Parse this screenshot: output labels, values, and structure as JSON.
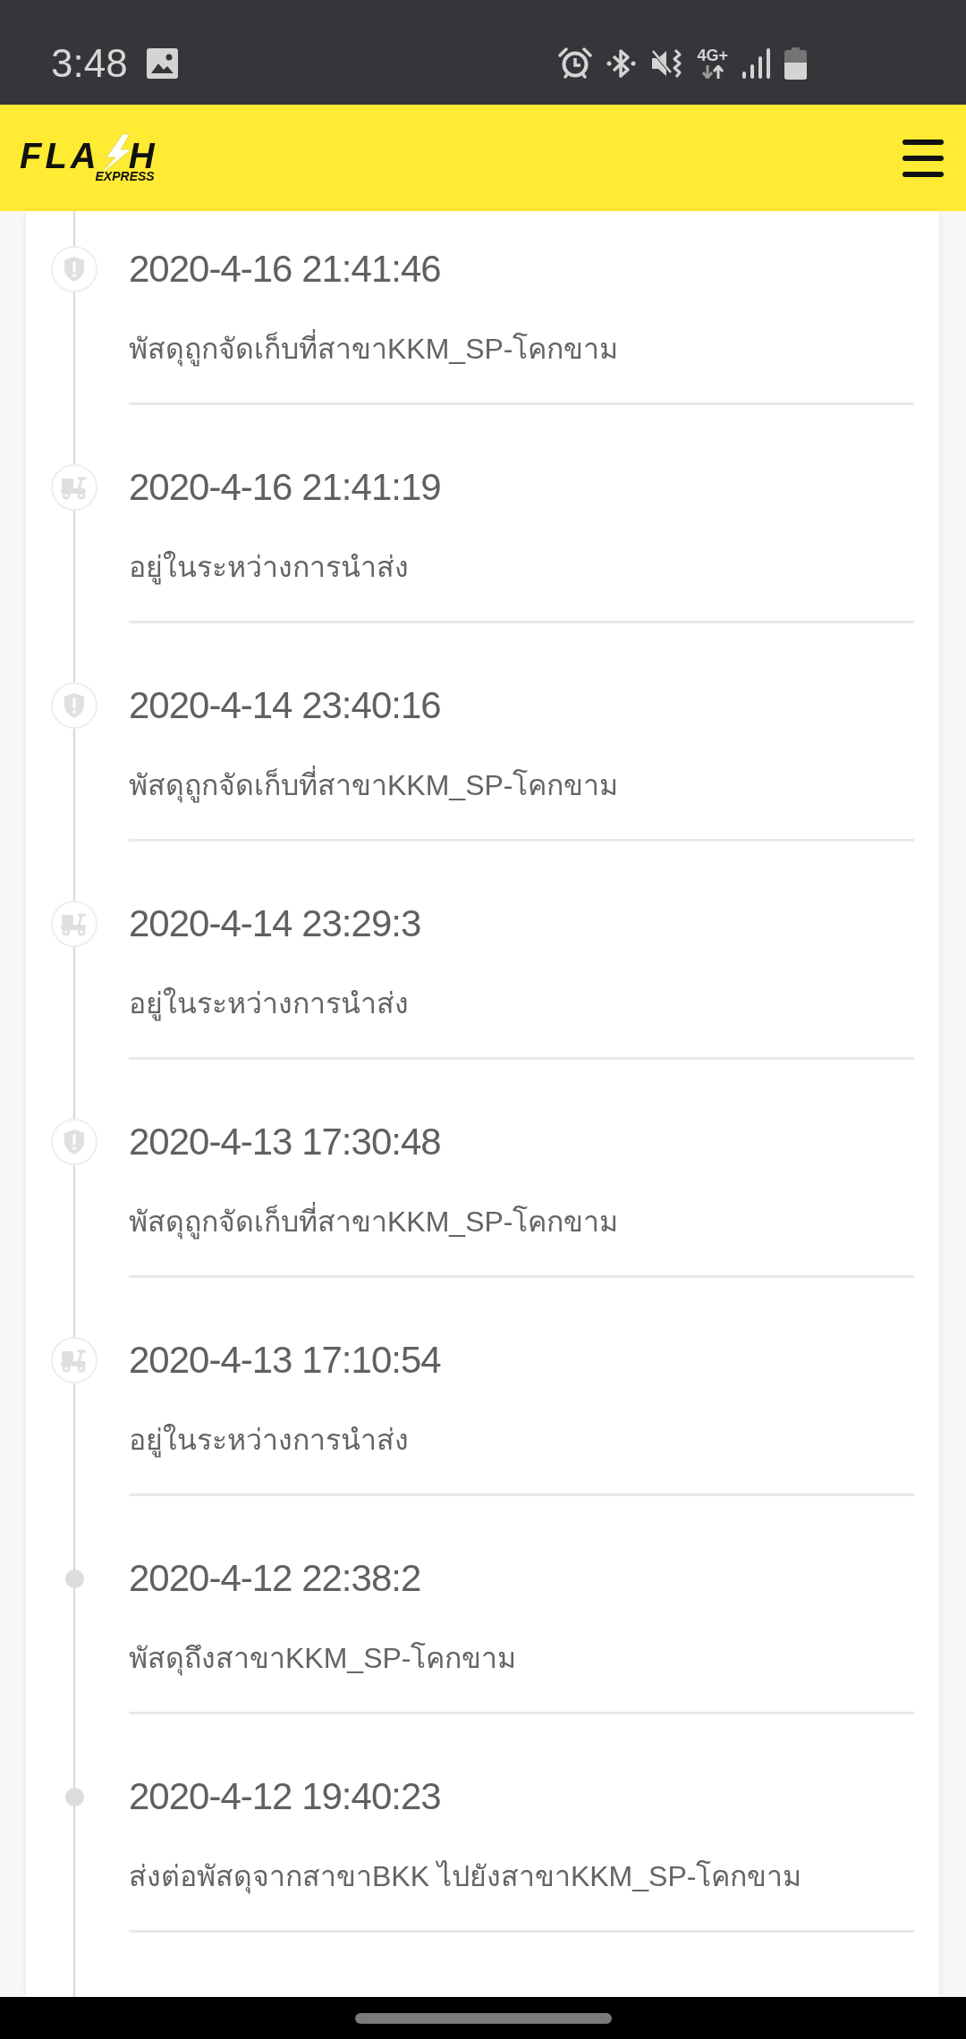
{
  "status_bar": {
    "time": "3:48",
    "network_type": "4G+"
  },
  "header": {
    "logo": {
      "wordmark_left": "FLA",
      "wordmark_right": "H",
      "tagline": "EXPRESS"
    }
  },
  "timeline": [
    {
      "kind": "shield",
      "date": "2020-4-16 21:41:46",
      "description": "พัสดุถูกจัดเก็บที่สาขาKKM_SP-โคกขาม"
    },
    {
      "kind": "scooter",
      "date": "2020-4-16 21:41:19",
      "description": "อยู่ในระหว่างการนำส่ง"
    },
    {
      "kind": "shield",
      "date": "2020-4-14 23:40:16",
      "description": "พัสดุถูกจัดเก็บที่สาขาKKM_SP-โคกขาม"
    },
    {
      "kind": "scooter",
      "date": "2020-4-14 23:29:3",
      "description": "อยู่ในระหว่างการนำส่ง"
    },
    {
      "kind": "shield",
      "date": "2020-4-13 17:30:48",
      "description": "พัสดุถูกจัดเก็บที่สาขาKKM_SP-โคกขาม"
    },
    {
      "kind": "scooter",
      "date": "2020-4-13 17:10:54",
      "description": "อยู่ในระหว่างการนำส่ง"
    },
    {
      "kind": "dot",
      "date": "2020-4-12 22:38:2",
      "description": "พัสดุถึงสาขาKKM_SP-โคกขาม"
    },
    {
      "kind": "dot",
      "date": "2020-4-12 19:40:23",
      "description": "ส่งต่อพัสดุจากสาขาBKK ไปยังสาขาKKM_SP-โคกขาม"
    }
  ]
}
